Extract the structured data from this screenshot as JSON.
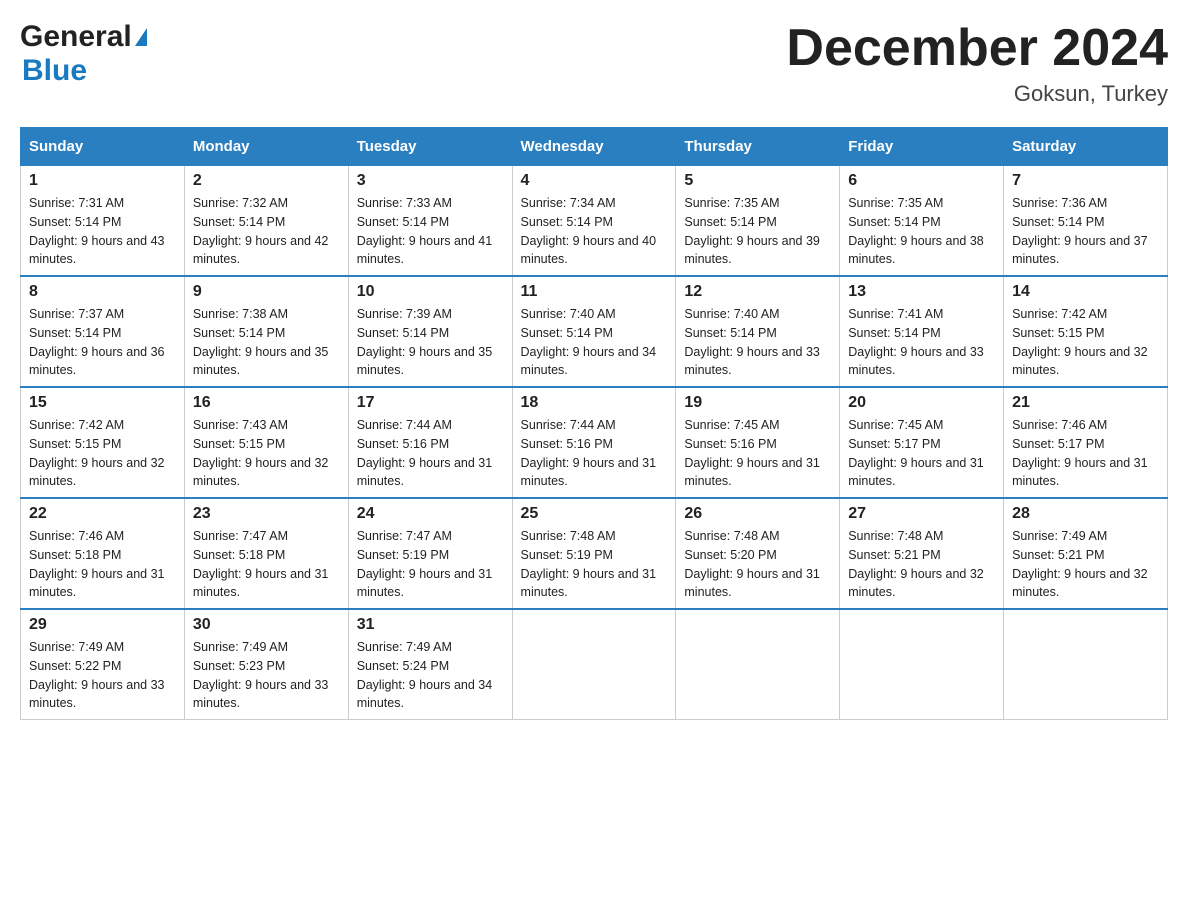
{
  "header": {
    "month_year": "December 2024",
    "location": "Goksun, Turkey"
  },
  "days_of_week": [
    "Sunday",
    "Monday",
    "Tuesday",
    "Wednesday",
    "Thursday",
    "Friday",
    "Saturday"
  ],
  "weeks": [
    [
      {
        "day": "1",
        "sunrise": "7:31 AM",
        "sunset": "5:14 PM",
        "daylight": "9 hours and 43 minutes."
      },
      {
        "day": "2",
        "sunrise": "7:32 AM",
        "sunset": "5:14 PM",
        "daylight": "9 hours and 42 minutes."
      },
      {
        "day": "3",
        "sunrise": "7:33 AM",
        "sunset": "5:14 PM",
        "daylight": "9 hours and 41 minutes."
      },
      {
        "day": "4",
        "sunrise": "7:34 AM",
        "sunset": "5:14 PM",
        "daylight": "9 hours and 40 minutes."
      },
      {
        "day": "5",
        "sunrise": "7:35 AM",
        "sunset": "5:14 PM",
        "daylight": "9 hours and 39 minutes."
      },
      {
        "day": "6",
        "sunrise": "7:35 AM",
        "sunset": "5:14 PM",
        "daylight": "9 hours and 38 minutes."
      },
      {
        "day": "7",
        "sunrise": "7:36 AM",
        "sunset": "5:14 PM",
        "daylight": "9 hours and 37 minutes."
      }
    ],
    [
      {
        "day": "8",
        "sunrise": "7:37 AM",
        "sunset": "5:14 PM",
        "daylight": "9 hours and 36 minutes."
      },
      {
        "day": "9",
        "sunrise": "7:38 AM",
        "sunset": "5:14 PM",
        "daylight": "9 hours and 35 minutes."
      },
      {
        "day": "10",
        "sunrise": "7:39 AM",
        "sunset": "5:14 PM",
        "daylight": "9 hours and 35 minutes."
      },
      {
        "day": "11",
        "sunrise": "7:40 AM",
        "sunset": "5:14 PM",
        "daylight": "9 hours and 34 minutes."
      },
      {
        "day": "12",
        "sunrise": "7:40 AM",
        "sunset": "5:14 PM",
        "daylight": "9 hours and 33 minutes."
      },
      {
        "day": "13",
        "sunrise": "7:41 AM",
        "sunset": "5:14 PM",
        "daylight": "9 hours and 33 minutes."
      },
      {
        "day": "14",
        "sunrise": "7:42 AM",
        "sunset": "5:15 PM",
        "daylight": "9 hours and 32 minutes."
      }
    ],
    [
      {
        "day": "15",
        "sunrise": "7:42 AM",
        "sunset": "5:15 PM",
        "daylight": "9 hours and 32 minutes."
      },
      {
        "day": "16",
        "sunrise": "7:43 AM",
        "sunset": "5:15 PM",
        "daylight": "9 hours and 32 minutes."
      },
      {
        "day": "17",
        "sunrise": "7:44 AM",
        "sunset": "5:16 PM",
        "daylight": "9 hours and 31 minutes."
      },
      {
        "day": "18",
        "sunrise": "7:44 AM",
        "sunset": "5:16 PM",
        "daylight": "9 hours and 31 minutes."
      },
      {
        "day": "19",
        "sunrise": "7:45 AM",
        "sunset": "5:16 PM",
        "daylight": "9 hours and 31 minutes."
      },
      {
        "day": "20",
        "sunrise": "7:45 AM",
        "sunset": "5:17 PM",
        "daylight": "9 hours and 31 minutes."
      },
      {
        "day": "21",
        "sunrise": "7:46 AM",
        "sunset": "5:17 PM",
        "daylight": "9 hours and 31 minutes."
      }
    ],
    [
      {
        "day": "22",
        "sunrise": "7:46 AM",
        "sunset": "5:18 PM",
        "daylight": "9 hours and 31 minutes."
      },
      {
        "day": "23",
        "sunrise": "7:47 AM",
        "sunset": "5:18 PM",
        "daylight": "9 hours and 31 minutes."
      },
      {
        "day": "24",
        "sunrise": "7:47 AM",
        "sunset": "5:19 PM",
        "daylight": "9 hours and 31 minutes."
      },
      {
        "day": "25",
        "sunrise": "7:48 AM",
        "sunset": "5:19 PM",
        "daylight": "9 hours and 31 minutes."
      },
      {
        "day": "26",
        "sunrise": "7:48 AM",
        "sunset": "5:20 PM",
        "daylight": "9 hours and 31 minutes."
      },
      {
        "day": "27",
        "sunrise": "7:48 AM",
        "sunset": "5:21 PM",
        "daylight": "9 hours and 32 minutes."
      },
      {
        "day": "28",
        "sunrise": "7:49 AM",
        "sunset": "5:21 PM",
        "daylight": "9 hours and 32 minutes."
      }
    ],
    [
      {
        "day": "29",
        "sunrise": "7:49 AM",
        "sunset": "5:22 PM",
        "daylight": "9 hours and 33 minutes."
      },
      {
        "day": "30",
        "sunrise": "7:49 AM",
        "sunset": "5:23 PM",
        "daylight": "9 hours and 33 minutes."
      },
      {
        "day": "31",
        "sunrise": "7:49 AM",
        "sunset": "5:24 PM",
        "daylight": "9 hours and 34 minutes."
      },
      null,
      null,
      null,
      null
    ]
  ]
}
